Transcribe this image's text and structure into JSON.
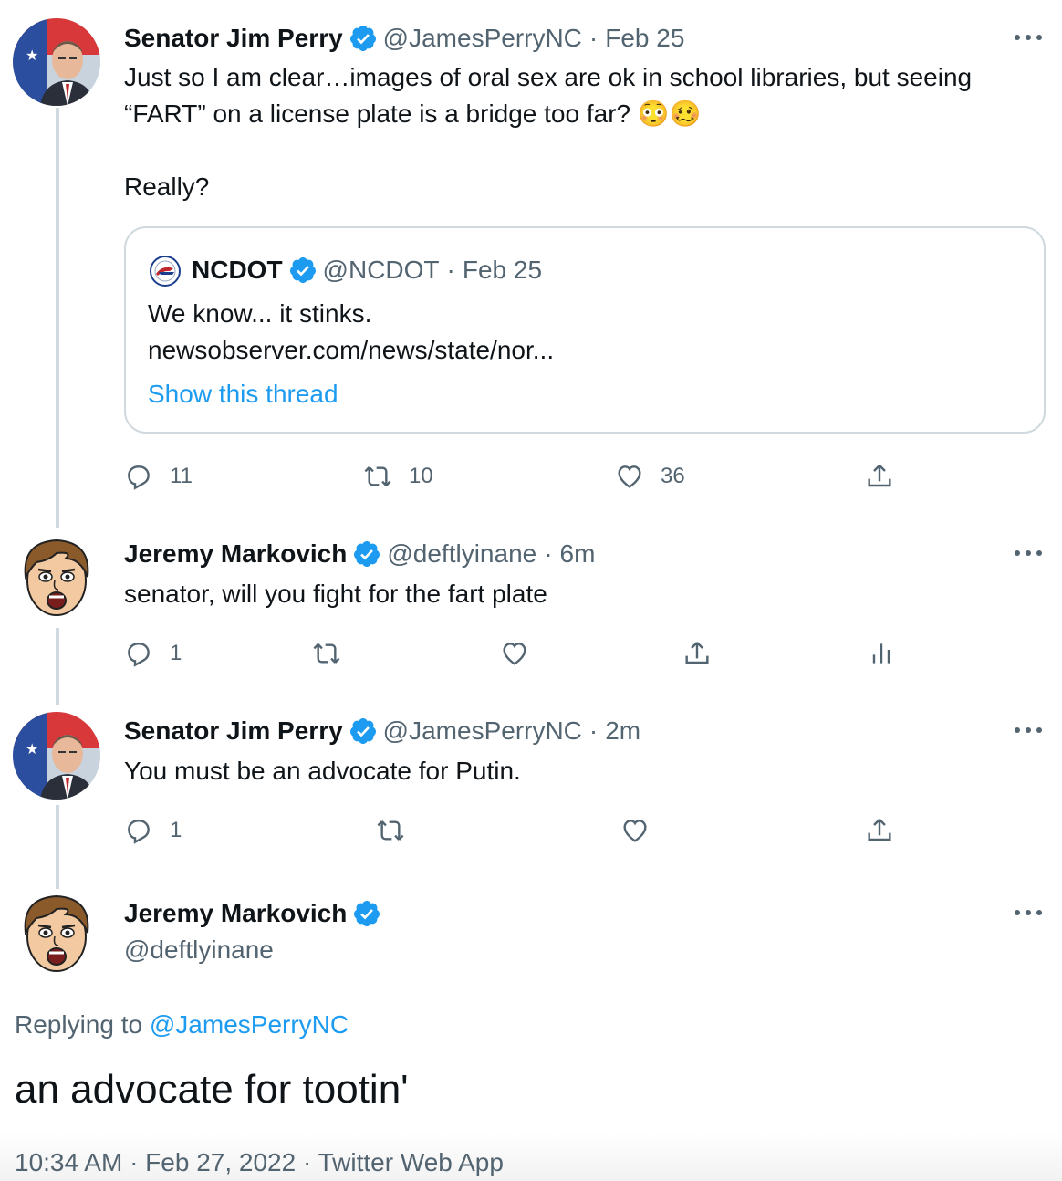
{
  "tweets": [
    {
      "name": "Senator Jim Perry",
      "handle": "@JamesPerryNC",
      "dot": "·",
      "time": "Feb 25",
      "text_line1": "Just so I am clear…images of oral sex are ok in school libraries, but seeing",
      "text_line2": "“FART” on a license plate is a bridge too far?  😳🥴",
      "text_line3": "Really?",
      "quote": {
        "name": "NCDOT",
        "handle": "@NCDOT",
        "dot": "·",
        "time": "Feb 25",
        "text": "We know... it stinks.",
        "url": "newsobserver.com/news/state/nor...",
        "show_thread": "Show this thread"
      },
      "replies": "11",
      "retweets": "10",
      "likes": "36"
    },
    {
      "name": "Jeremy Markovich",
      "handle": "@deftlyinane",
      "dot": "·",
      "time": "6m",
      "text": "senator, will you fight for the fart plate",
      "replies": "1"
    },
    {
      "name": "Senator Jim Perry",
      "handle": "@JamesPerryNC",
      "dot": "·",
      "time": "2m",
      "text": "You must be an advocate for Putin.",
      "replies": "1"
    }
  ],
  "main_tweet": {
    "name": "Jeremy Markovich",
    "handle": "@deftlyinane",
    "replying_prefix": "Replying to ",
    "replying_handle": "@JamesPerryNC",
    "text": "an advocate for tootin'",
    "timestamp": "10:34 AM · Feb 27, 2022 · Twitter Web App"
  },
  "colors": {
    "accent": "#1d9bf0",
    "secondary_text": "#536471",
    "border": "#cfd9de"
  },
  "icons": [
    "verified-badge-icon",
    "more-icon",
    "reply-icon",
    "retweet-icon",
    "like-icon",
    "share-icon",
    "analytics-icon"
  ]
}
